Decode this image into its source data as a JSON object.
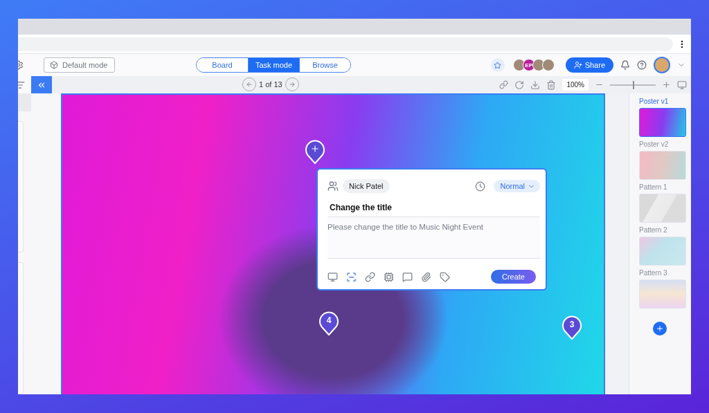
{
  "header": {
    "mode_button": "Default mode",
    "tabs": [
      {
        "label": "Board",
        "selected": false
      },
      {
        "label": "Task mode",
        "selected": true
      },
      {
        "label": "Browse",
        "selected": false
      }
    ],
    "collaborators": [
      {
        "kind": "photo"
      },
      {
        "kind": "initials",
        "initials": "EP",
        "color": "#b8209c"
      },
      {
        "kind": "photo"
      },
      {
        "kind": "photo"
      }
    ],
    "share_button": "Share"
  },
  "toolbar": {
    "page_indicator": "1 of 13",
    "zoom": "100%",
    "zoom_level": {
      "level": 0.5
    }
  },
  "canvas": {
    "markers": [
      {
        "label": "4"
      },
      {
        "label": "3"
      }
    ]
  },
  "task_popup": {
    "assignee": "Nick Patel",
    "priority": "Normal",
    "title": "Change the title",
    "description_placeholder": "Please change the title to Music Night Event",
    "create_button": "Create"
  },
  "variants": [
    {
      "label": "Poster v1",
      "selected": true,
      "kind": "poster1"
    },
    {
      "label": "Poster v2",
      "selected": false,
      "kind": "poster2"
    },
    {
      "label": "Pattern 1",
      "selected": false,
      "kind": "pattern1"
    },
    {
      "label": "Pattern 2",
      "selected": false,
      "kind": "pattern2"
    },
    {
      "label": "Pattern 3",
      "selected": false,
      "kind": "pattern3"
    }
  ]
}
